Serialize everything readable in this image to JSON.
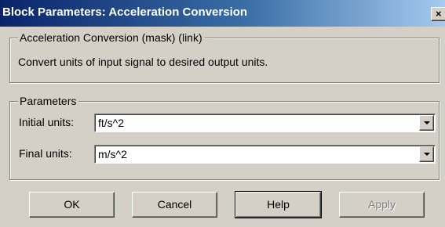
{
  "window": {
    "title": "Block Parameters: Acceleration Conversion",
    "close_glyph": "×"
  },
  "description_group": {
    "legend": "Acceleration Conversion (mask) (link)",
    "text": "Convert units of input signal to desired output units."
  },
  "parameters_group": {
    "legend": "Parameters",
    "initial_units": {
      "label": "Initial units:",
      "value": "ft/s^2"
    },
    "final_units": {
      "label": "Final units:",
      "value": "m/s^2"
    }
  },
  "buttons": {
    "ok": "OK",
    "cancel": "Cancel",
    "help": "Help",
    "apply": "Apply"
  },
  "colors": {
    "title_gradient_start": "#0a246a",
    "title_gradient_end": "#a6caf0",
    "dialog_background": "#d4d0c8"
  }
}
